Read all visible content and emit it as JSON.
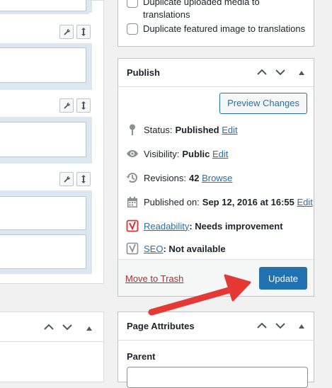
{
  "language_box": {
    "checkbox_media_label_line1": "Duplicate uploaded media to",
    "checkbox_media_label_line2": "translations",
    "checkbox_featured_label": "Duplicate featured image to translations"
  },
  "publish": {
    "title": "Publish",
    "preview_button": "Preview Changes",
    "status_label": "Status:",
    "status_value": "Published",
    "status_edit": "Edit",
    "visibility_label": "Visibility:",
    "visibility_value": "Public",
    "visibility_edit": "Edit",
    "revisions_label": "Revisions:",
    "revisions_value": "42",
    "revisions_browse": "Browse",
    "published_label": "Published on:",
    "published_value": "Sep 12, 2016 at 16:55",
    "published_edit": "Edit",
    "readability_link": "Readability",
    "readability_value": ": Needs improvement",
    "seo_link": "SEO",
    "seo_value": ": Not available",
    "trash_link": "Move to Trash",
    "update_button": "Update"
  },
  "page_attributes": {
    "title": "Page Attributes",
    "parent_label": "Parent"
  },
  "colors": {
    "primary": "#2271b1",
    "trash": "#b32d2e",
    "yoast_red": "#dc3232",
    "arrow": "#e53935"
  },
  "icons": {
    "field_settings": "wrench-icon",
    "field_move": "move-icon",
    "collapse_up": "chevron-up-icon",
    "collapse_down": "chevron-down-icon",
    "toggle": "triangle-up-icon",
    "status": "pin-icon",
    "visibility": "eye-icon",
    "revisions": "history-icon",
    "published": "calendar-icon",
    "readability": "yoast-icon",
    "seo": "yoast-icon"
  }
}
